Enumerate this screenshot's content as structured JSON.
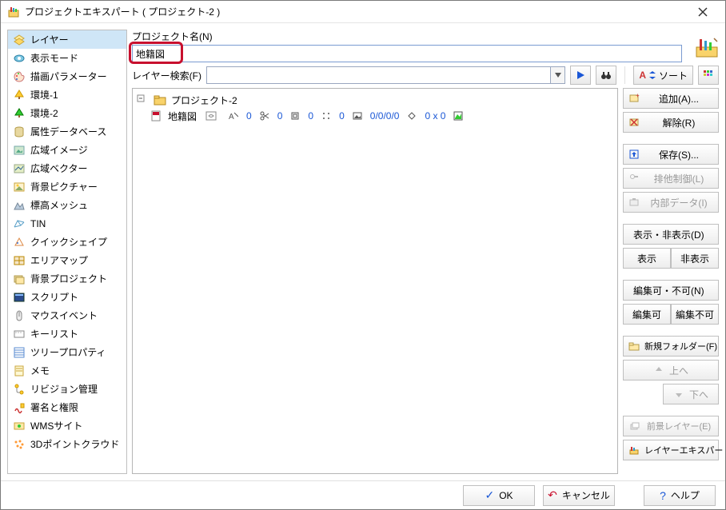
{
  "title": "プロジェクトエキスパート ( プロジェクト-2 )",
  "sidebar": [
    {
      "label": "レイヤー",
      "selected": true,
      "icon": "layers"
    },
    {
      "label": "表示モード",
      "icon": "eye"
    },
    {
      "label": "描画パラメーター",
      "icon": "palette"
    },
    {
      "label": "環境-1",
      "icon": "tree"
    },
    {
      "label": "環境-2",
      "icon": "tree"
    },
    {
      "label": "属性データベース",
      "icon": "db"
    },
    {
      "label": "広域イメージ",
      "icon": "image"
    },
    {
      "label": "広域ベクター",
      "icon": "vector"
    },
    {
      "label": "背景ピクチャー",
      "icon": "picture"
    },
    {
      "label": "標高メッシュ",
      "icon": "terrain"
    },
    {
      "label": "TIN",
      "icon": "tin"
    },
    {
      "label": "クイックシェイプ",
      "icon": "quick"
    },
    {
      "label": "エリアマップ",
      "icon": "area"
    },
    {
      "label": "背景プロジェクト",
      "icon": "bgproj"
    },
    {
      "label": "スクリプト",
      "icon": "script"
    },
    {
      "label": "マウスイベント",
      "icon": "mouse"
    },
    {
      "label": "キーリスト",
      "icon": "keylist"
    },
    {
      "label": "ツリープロパティ",
      "icon": "treeprop"
    },
    {
      "label": "メモ",
      "icon": "memo"
    },
    {
      "label": "リビジョン管理",
      "icon": "rev"
    },
    {
      "label": "署名と権限",
      "icon": "sign"
    },
    {
      "label": "WMSサイト",
      "icon": "wms"
    },
    {
      "label": "3Dポイントクラウド",
      "icon": "pcloud"
    }
  ],
  "project_name_label": "プロジェクト名(N)",
  "project_name_value": "地籍図",
  "layer_search_label": "レイヤー検索(F)",
  "layer_search_value": "",
  "sort_label": "ソート",
  "tree": {
    "root": "プロジェクト-2",
    "layer": {
      "name": "地籍図",
      "stats": [
        "0",
        "0",
        "0",
        "0",
        "0/0/0/0",
        "0 x 0"
      ]
    }
  },
  "right_buttons": {
    "add": "追加(A)...",
    "remove": "解除(R)",
    "save": "保存(S)...",
    "lock": "排他制御(L)",
    "internal": "内部データ(I)",
    "visibility_head": "表示・非表示(D)",
    "show": "表示",
    "hide": "非表示",
    "editable_head": "編集可・不可(N)",
    "edit_on": "編集可",
    "edit_off": "編集不可",
    "new_folder": "新規フォルダー(F)",
    "up": "上へ",
    "down": "下へ",
    "foreground": "前景レイヤー(E)",
    "layer_expert": "レイヤーエキスパート"
  },
  "footer": {
    "ok": "OK",
    "cancel": "キャンセル",
    "help": "ヘルプ"
  }
}
